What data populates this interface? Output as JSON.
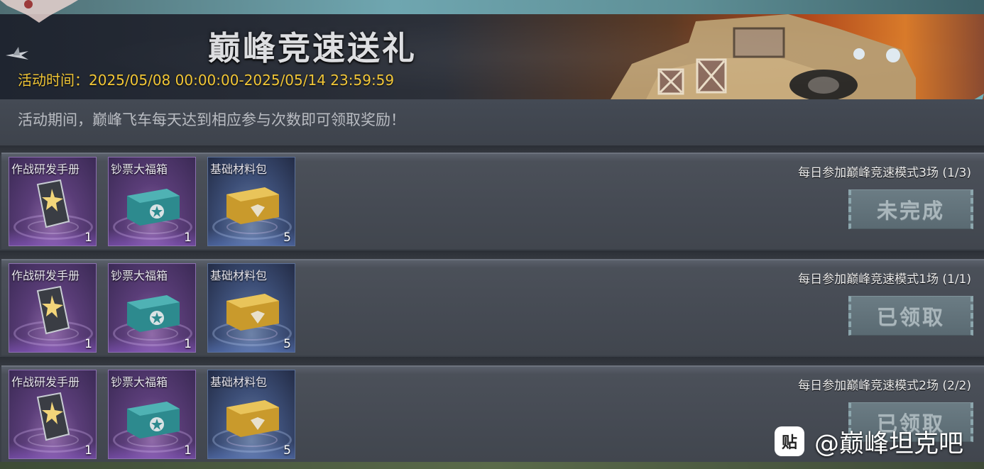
{
  "banner": {
    "title": "巅峰竞速送礼",
    "time": "活动时间：2025/05/08 00:00:00-2025/05/14 23:59:59"
  },
  "description": "活动期间，巅峰飞车每天达到相应参与次数即可领取奖励！",
  "rewards_header": null,
  "tasks": [
    {
      "label": "每日参加巅峰竞速模式3场 (1/3)",
      "status": "未完成",
      "items": [
        {
          "name": "作战研发手册",
          "count": "1",
          "icon": "manual-card-icon"
        },
        {
          "name": "钞票大福箱",
          "count": "1",
          "icon": "teal-crate-icon"
        },
        {
          "name": "基础材料包",
          "count": "5",
          "icon": "gold-crate-icon"
        }
      ]
    },
    {
      "label": "每日参加巅峰竞速模式1场 (1/1)",
      "status": "已领取",
      "items": [
        {
          "name": "作战研发手册",
          "count": "1",
          "icon": "manual-card-icon"
        },
        {
          "name": "钞票大福箱",
          "count": "1",
          "icon": "teal-crate-icon"
        },
        {
          "name": "基础材料包",
          "count": "5",
          "icon": "gold-crate-icon"
        }
      ]
    },
    {
      "label": "每日参加巅峰竞速模式2场 (2/2)",
      "status": "已领取",
      "items": [
        {
          "name": "作战研发手册",
          "count": "1",
          "icon": "manual-card-icon"
        },
        {
          "name": "钞票大福箱",
          "count": "1",
          "icon": "teal-crate-icon"
        },
        {
          "name": "基础材料包",
          "count": "5",
          "icon": "gold-crate-icon"
        }
      ]
    }
  ],
  "watermark": {
    "logo_text": "贴",
    "text": "@巅峰坦克吧"
  },
  "colors": {
    "time_text": "#f1c636",
    "item_purple": "#5a3d78",
    "item_blue": "#3d4f78",
    "button": "#5a6a72"
  }
}
